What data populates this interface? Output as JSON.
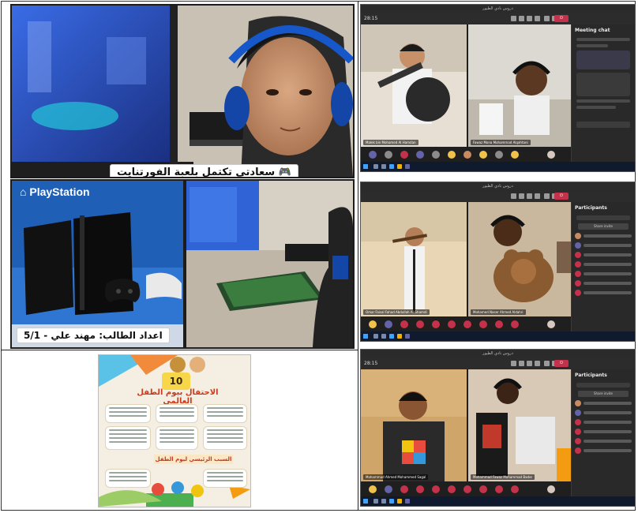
{
  "left_top": {
    "caption": "سعادتي تكتمل بلعبة الفورتنايت",
    "controller_icon": "gamepad-icon"
  },
  "left_middle": {
    "brand": "PlayStation",
    "brand_icon": "playstation-logo-icon",
    "author_caption": "اعداد الطالب: مهند علي - 5/1"
  },
  "poster": {
    "badge": "10",
    "title": "الاحتفال بيوم الطفل العالمي",
    "subtitle": "السبب الرئيسي ليوم الطفل"
  },
  "teams_window_title": "دروس نادي الطيور",
  "teams_panels": [
    {
      "time": "28:15",
      "side_title": "Meeting chat",
      "video_names": [
        "Malek bin Mohamed Al Hamdan",
        "Fawaz Mona Mohammad Alqahtani"
      ]
    },
    {
      "time": "",
      "side_title": "Participants",
      "side_button": "Share invite",
      "video_names": [
        "Omar Faisal Fahad Abdullah Al Ghamdi",
        "Mohamed Naser Ahmed Aldahri"
      ]
    },
    {
      "time": "28:15",
      "side_title": "Participants",
      "side_button": "Share invite",
      "video_names": [
        "Mohammad Ahmed Mohammed Sagal",
        "Mohammad Fawaz Mohammad Bader"
      ]
    }
  ],
  "colors": {
    "leave_red": "#c4314b",
    "teams_dark": "#1f1f1f",
    "caption_text": "#111111",
    "ps_blue": "#1f5fb5"
  }
}
